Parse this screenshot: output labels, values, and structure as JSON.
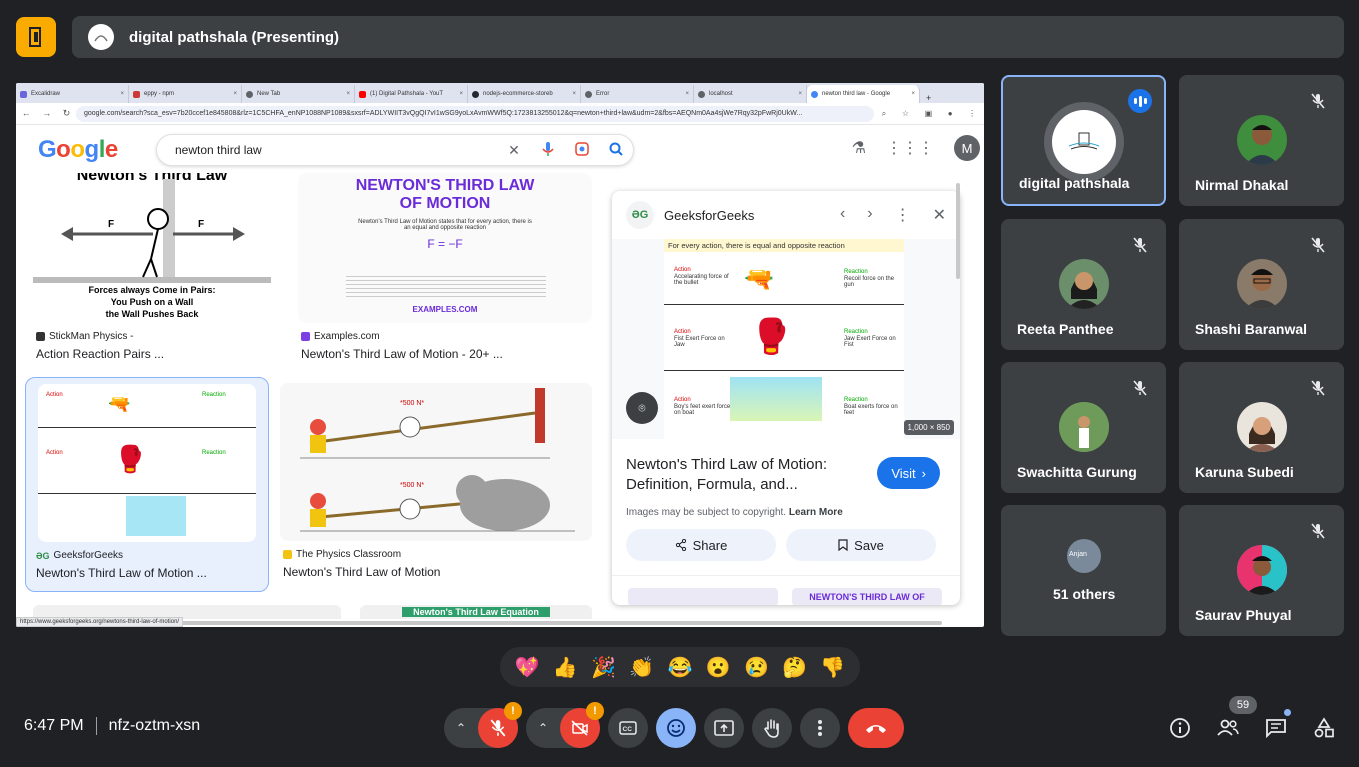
{
  "meeting": {
    "title": "digital pathshala (Presenting)",
    "time": "6:47 PM",
    "code": "nfz-oztm-xsn",
    "participant_count": "59"
  },
  "browser": {
    "tabs": [
      {
        "label": "Excalidraw",
        "color": "#6965db"
      },
      {
        "label": "eppy - npm",
        "color": "#cb3837"
      },
      {
        "label": "New Tab",
        "color": "#5f6368"
      },
      {
        "label": "(1) Digital Pathshala - YouT",
        "color": "#ff0000"
      },
      {
        "label": "nodejs-ecommerce-storeb",
        "color": "#24292f"
      },
      {
        "label": "Error",
        "color": "#5f6368"
      },
      {
        "label": "localhost",
        "color": "#5f6368"
      },
      {
        "label": "newton third law - Google",
        "color": "#4285f4"
      }
    ],
    "url": "google.com/search?sca_esv=7b20ccef1e845808&rlz=1C5CHFA_enNP1088NP1089&sxsrf=ADLYWIIT3vQgQI7vI1wSG9yoLxAvmWWf5Q:1723813255012&q=newton+third+law&udm=2&fbs=AEQNm0Aa4sjWe7Rqy32pFwRj0UkW...",
    "status_url": "https://www.geeksforgeeks.org/newtons-third-law-of-motion/"
  },
  "google": {
    "logo": "Google",
    "query": "newton third law",
    "avatar": "M",
    "results": [
      {
        "source": "StickMan Physics -",
        "title": "Action Reaction Pairs ...",
        "img_title": "Newton's Third Law",
        "img_caption": [
          "Forces always Come in Pairs:",
          "You Push on a Wall",
          "the Wall Pushes Back"
        ],
        "f2": "F",
        "f1": "F"
      },
      {
        "source": "Examples.com",
        "title": "Newton's Third Law of Motion - 20+ ...",
        "img_title": [
          "NEWTON'S THIRD LAW",
          "OF MOTION"
        ],
        "img_sub": "Newton's Third Law of Motion states that for every action, there is an equal and opposite reaction",
        "img_formula": "F   = −F",
        "img_foot": "EXAMPLES.COM"
      },
      {
        "source": "GeeksforGeeks",
        "title": "Newton's Third Law of Motion ..."
      },
      {
        "source": "The Physics Classroom",
        "title": "Newton's Third Law of Motion",
        "img_label": "*500 N*"
      }
    ],
    "bottom_peek": "Newton's Third Law Equation"
  },
  "panel": {
    "source": "GeeksforGeeks",
    "img_header": "For every action, there is equal and opposite reaction",
    "rows": [
      {
        "action": "Action",
        "action_desc": "Accelarating force of the bullet",
        "reaction": "Reaction",
        "reaction_desc": "Recoil force on the gun"
      },
      {
        "action": "Action",
        "action_desc": "Fist Exert Force on Jaw",
        "reaction": "Reaction",
        "reaction_desc": "Jaw Exert Force on Fist"
      },
      {
        "action": "Action",
        "action_desc": "Boy's feet exert force on boat",
        "reaction": "Reaction",
        "reaction_desc": "Boat exerts force on feet"
      }
    ],
    "dims": "1,000 × 850",
    "title": "Newton's Third Law of Motion: Definition, Formula, and...",
    "visit": "Visit",
    "copyright": "Images may be subject to copyright.",
    "learn_more": "Learn More",
    "share": "Share",
    "save": "Save",
    "peek": "NEWTON'S THIRD LAW OF"
  },
  "participants": [
    {
      "name": "digital pathshala",
      "speaking": true
    },
    {
      "name": "Nirmal Dhakal",
      "muted": true
    },
    {
      "name": "Reeta Panthee",
      "muted": true
    },
    {
      "name": "Shashi Baranwal",
      "muted": true
    },
    {
      "name": "Swachitta Gurung",
      "muted": true
    },
    {
      "name": "Karuna Subedi",
      "muted": true
    },
    {
      "name": "51 others",
      "avatar_label": "Anjan"
    },
    {
      "name": "Saurav Phuyal",
      "muted": true
    }
  ],
  "reactions": [
    "💖",
    "👍",
    "🎉",
    "👏",
    "😂",
    "😮",
    "😢",
    "🤔",
    "👎"
  ],
  "controls": {
    "warn": "!",
    "icons": [
      "mic-off-icon",
      "camera-off-icon",
      "captions-icon",
      "emoji-icon",
      "present-icon",
      "raise-hand-icon",
      "more-icon",
      "end-call-icon"
    ]
  },
  "colors": {
    "accent": "#8ab4f8",
    "danger": "#ea4335",
    "warning": "#f29900",
    "brand_yellow": "#f9ab00"
  }
}
